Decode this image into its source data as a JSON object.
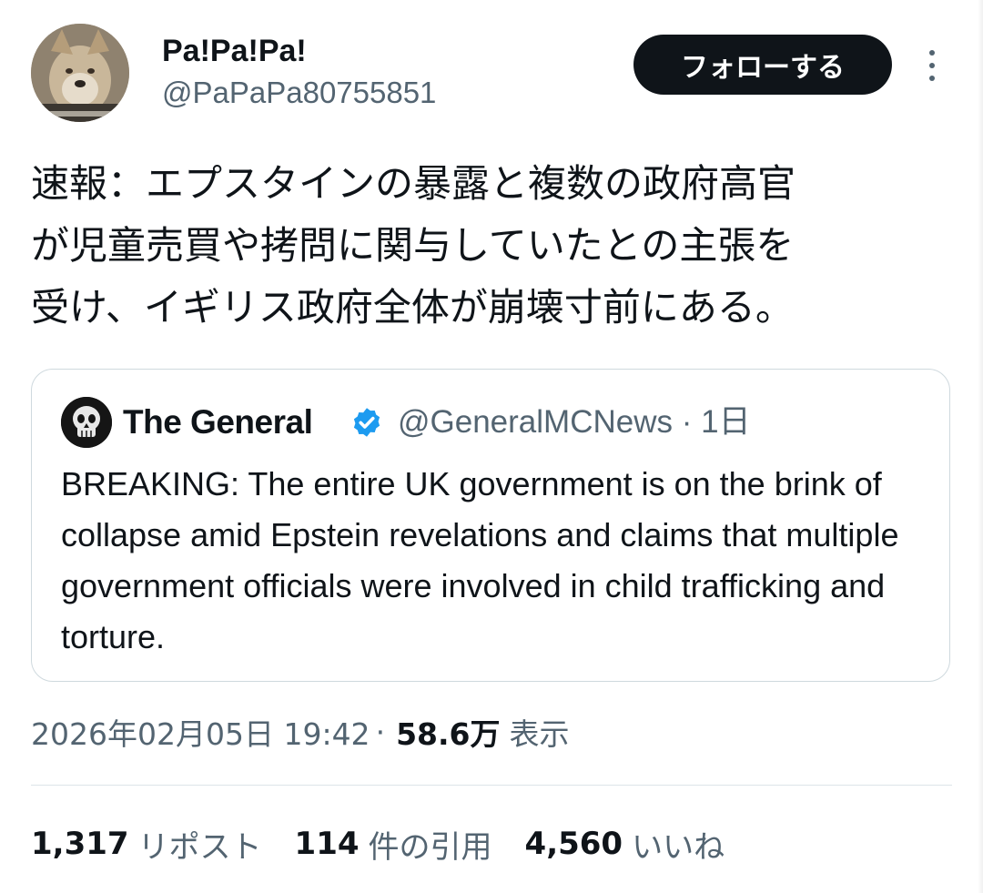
{
  "author": {
    "display_name": "Pa!Pa!Pa!",
    "handle": "@PaPaPa80755851",
    "avatar_icon": "shiba-dog-avatar"
  },
  "follow_button": {
    "label": "フォローする"
  },
  "more_menu": {
    "icon": "more-vertical-icon"
  },
  "tweet": {
    "text": "速報：エプスタインの暴露と複数の政府高官\nが児童売買や拷問に関与していたとの主張を\n受け、イギリス政府全体が崩壊寸前にある。"
  },
  "quote": {
    "display_name": "The General",
    "verified": true,
    "handle": "@GeneralMCNews",
    "separator": "·",
    "time": "1日",
    "text": "BREAKING: The entire UK government is on the brink of collapse amid Epstein revelations and claims that multiple government officials were involved in child trafficking and torture.",
    "avatar_icon": "skull-avatar"
  },
  "meta": {
    "timestamp": "2026年02月05日 19:42",
    "separator": "·",
    "views_count": "58.6万",
    "views_label": "表示"
  },
  "stats": {
    "reposts": {
      "count": "1,317",
      "label": "リポスト"
    },
    "quotes": {
      "count": "114",
      "label": "件の引用"
    },
    "likes": {
      "count": "4,560",
      "label": "いいね"
    }
  },
  "colors": {
    "primary_text": "#0f1419",
    "secondary_text": "#536471",
    "verified_blue": "#1d9bf0",
    "border": "#cfd9de",
    "button_bg": "#0f1419"
  }
}
